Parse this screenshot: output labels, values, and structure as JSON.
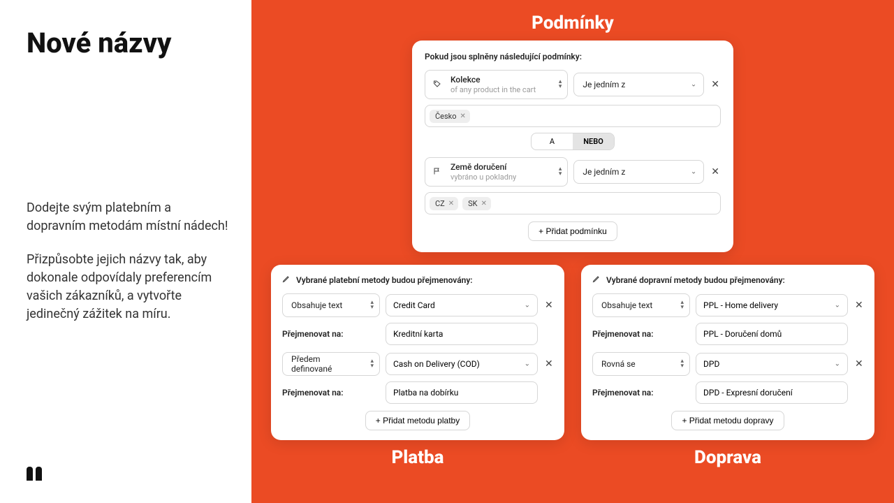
{
  "left": {
    "heading": "Nové názvy",
    "p1": "Dodejte svým platebním a dopravním metodám místní nádech!",
    "p2": "Přizpůsobte jejich názvy tak, aby dokonale odpovídaly preferencím vašich zákazníků, a vytvořte jedinečný zážitek na míru."
  },
  "conditions": {
    "title": "Podmínky",
    "head": "Pokud jsou splněny následující podmínky:",
    "row1": {
      "fieldTitle": "Kolekce",
      "fieldSub": "of any product in the cart",
      "op": "Je jedním z"
    },
    "tags1": [
      "Česko"
    ],
    "seg": {
      "a": "A",
      "or": "NEBO"
    },
    "row2": {
      "fieldTitle": "Země doručení",
      "fieldSub": "vybráno u pokladny",
      "op": "Je jedním z"
    },
    "tags2": [
      "CZ",
      "SK"
    ],
    "add": "+ Přidat podmínku"
  },
  "payment": {
    "title": "Platba",
    "head": "Vybrané platební metody budou přejmenovány:",
    "r1": {
      "sel": "Obsahuje text",
      "val": "Credit Card",
      "label": "Přejmenovat na:",
      "rename": "Kreditní karta"
    },
    "r2": {
      "sel": "Předem definované",
      "val": "Cash on Delivery (COD)",
      "label": "Přejmenovat na:",
      "rename": "Platba na dobírku"
    },
    "add": "+ Přidat metodu platby"
  },
  "shipping": {
    "title": "Doprava",
    "head": "Vybrané dopravní metody budou přejmenovány:",
    "r1": {
      "sel": "Obsahuje text",
      "val": "PPL - Home delivery",
      "label": "Přejmenovat na:",
      "rename": "PPL - Doručení domů"
    },
    "r2": {
      "sel": "Rovná se",
      "val": "DPD",
      "label": "Přejmenovat na:",
      "rename": "DPD - Expresní doručení"
    },
    "add": "+ Přidat metodu dopravy"
  }
}
